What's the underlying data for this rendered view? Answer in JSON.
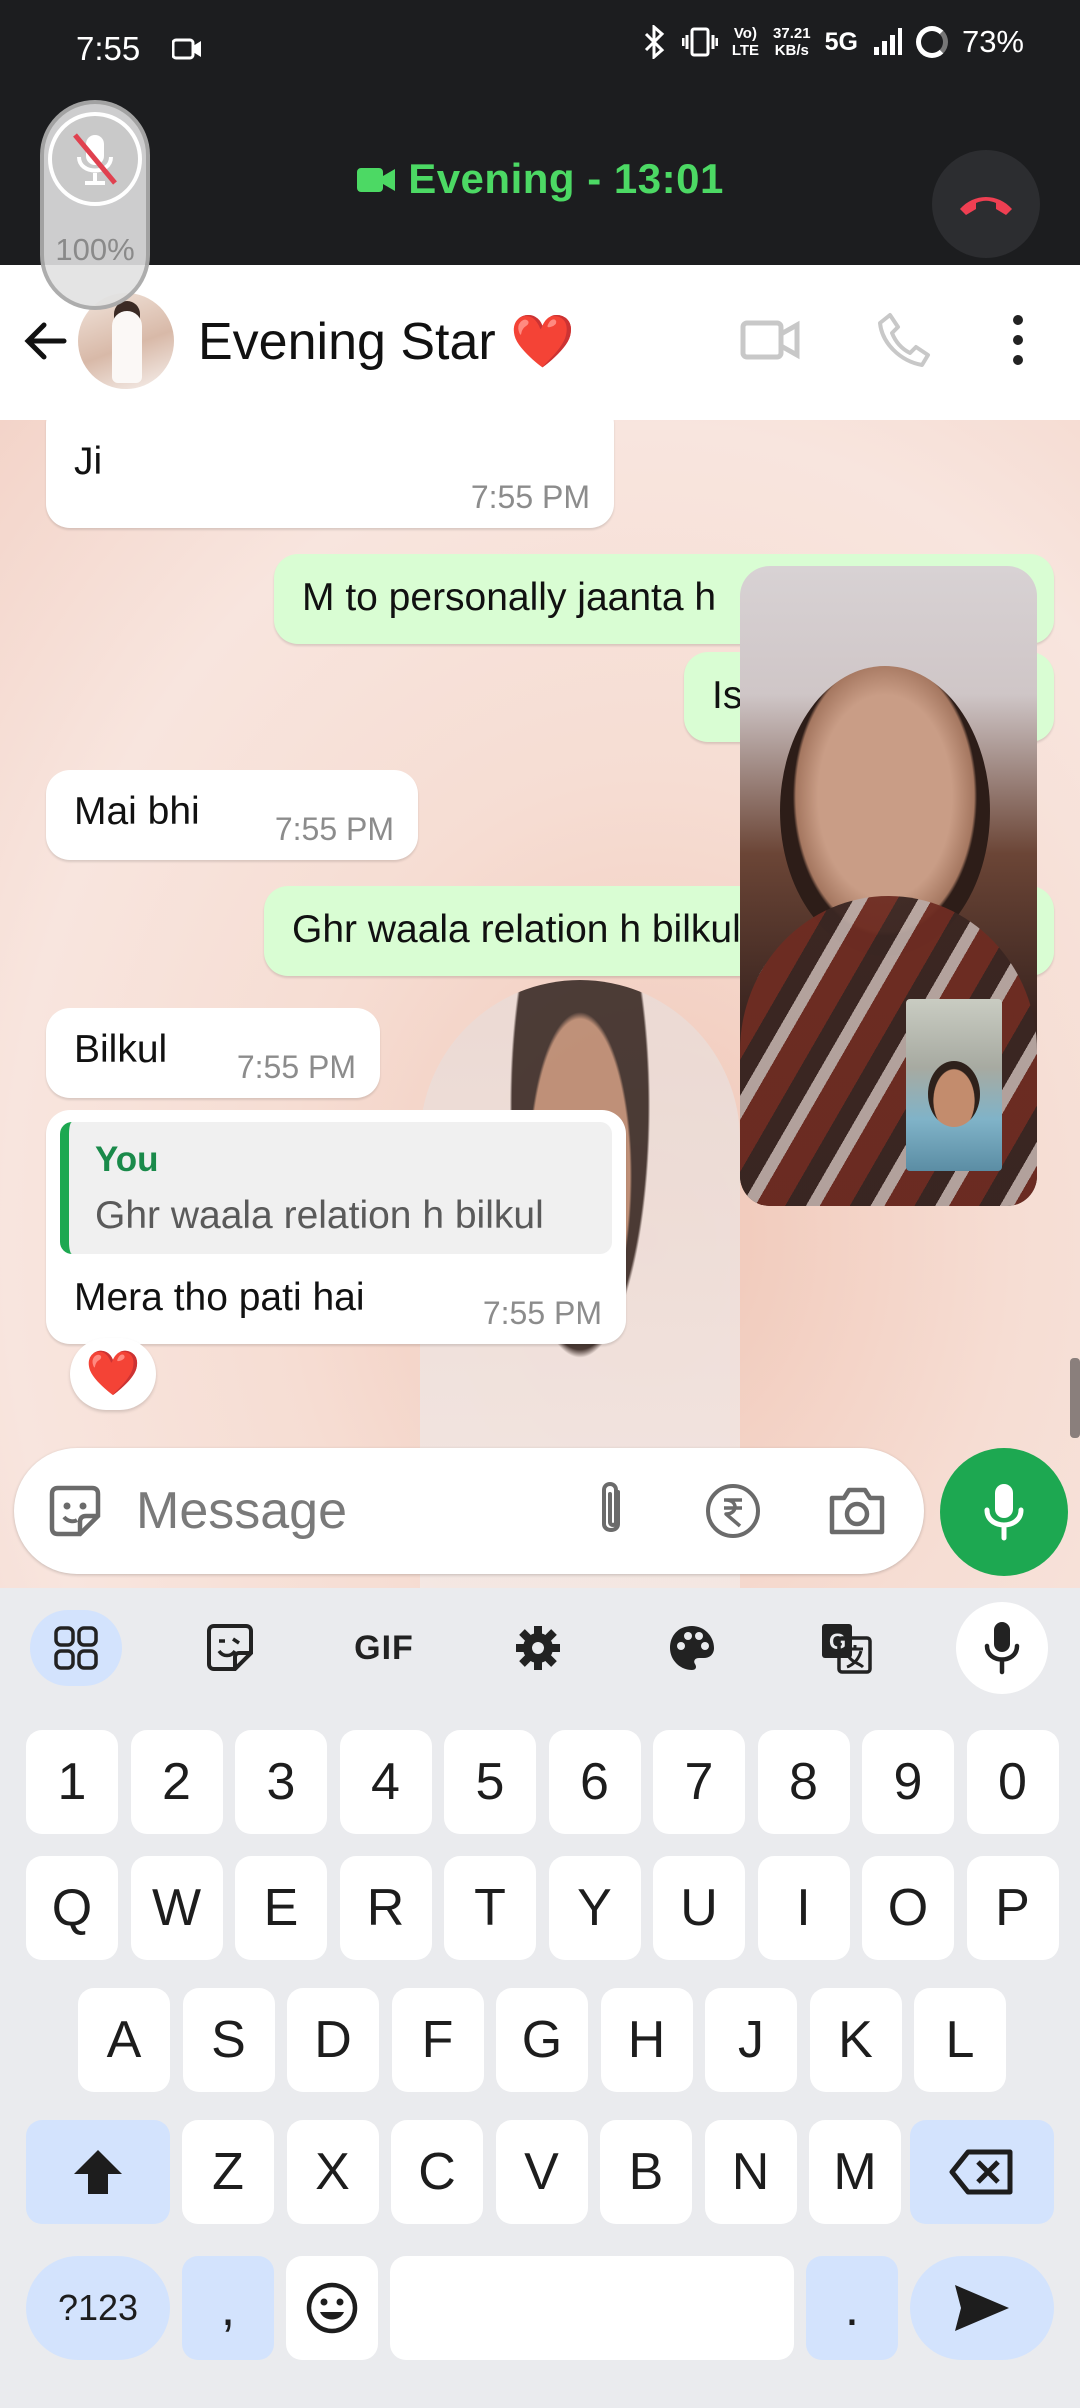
{
  "status_bar": {
    "time": "7:55",
    "network_top": "37.21",
    "network_bottom": "KB/s",
    "network_type": "5G",
    "volte_top": "Vo)",
    "volte_bottom": "LTE",
    "battery": "73%"
  },
  "call": {
    "title": "Evening - 13:01",
    "mute_percent": "100%",
    "accent_color": "#4cd964",
    "end_color": "#ef3f52"
  },
  "chat_header": {
    "contact_name": "Evening Star ❤️"
  },
  "messages": [
    {
      "side": "in",
      "text": "Ji",
      "time": "7:55 PM"
    },
    {
      "side": "out",
      "text": "M to personally jaanta h"
    },
    {
      "side": "out",
      "text": "Is"
    },
    {
      "side": "in",
      "text": "Mai bhi",
      "time": "7:55 PM"
    },
    {
      "side": "out",
      "text": "Ghr waala relation h bilkul"
    },
    {
      "side": "in",
      "text": "Bilkul",
      "time": "7:55 PM"
    },
    {
      "side": "in",
      "reply_name": "You",
      "reply_text": "Ghr waala relation h bilkul",
      "text": "Mera tho pati hai",
      "time": "7:55 PM",
      "reaction": "❤️"
    }
  ],
  "composer": {
    "placeholder": "Message"
  },
  "keyboard": {
    "toolbar_gif": "GIF",
    "number_row": [
      "1",
      "2",
      "3",
      "4",
      "5",
      "6",
      "7",
      "8",
      "9",
      "0"
    ],
    "row_1": [
      "Q",
      "W",
      "E",
      "R",
      "T",
      "Y",
      "U",
      "I",
      "O",
      "P"
    ],
    "row_2": [
      "A",
      "S",
      "D",
      "F",
      "G",
      "H",
      "J",
      "K",
      "L"
    ],
    "row_3": [
      "Z",
      "X",
      "C",
      "V",
      "B",
      "N",
      "M"
    ],
    "symbols_key": "?123",
    "comma_key": ",",
    "period_key": "."
  },
  "colors": {
    "whatsapp_green": "#1da851",
    "bubble_out": "#d9fdd3",
    "key_special": "#d3e3fd"
  }
}
